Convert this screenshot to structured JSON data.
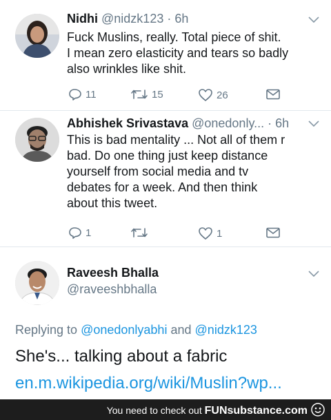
{
  "tweets": [
    {
      "name": "Nidhi",
      "handle": "@nidzk123",
      "time": "· 6h",
      "text": "Fuck Muslins, really. Total piece of shit.\nI mean zero elasticity and tears so badly\nalso wrinkles like shit.",
      "replies": "11",
      "retweets": "15",
      "likes": "26"
    },
    {
      "name": "Abhishek Srivastava",
      "handle": "@onedonly...",
      "time": "· 6h",
      "text": "This is bad mentality ... Not all of them r\nbad. Do one thing just keep distance\nyourself from social media and tv\ndebates for a week. And then think\nabout this tweet.",
      "replies": "1",
      "retweets": "",
      "likes": "1"
    }
  ],
  "main_tweet": {
    "name": "Raveesh Bhalla",
    "handle": "@raveeshbhalla",
    "replying_prefix": "Replying to",
    "replying_to_1": "@onedonlyabhi",
    "replying_and": "and",
    "replying_to_2": "@nidzk123",
    "text": "She's... talking about a fabric",
    "link": "en.m.wikipedia.org/wiki/Muslin?wp..."
  },
  "footer": {
    "prefix": "You need to check out",
    "brand": "FUNsubstance.com"
  },
  "colors": {
    "link": "#1b95e0",
    "muted": "#657786",
    "footer_bg": "#1d1d1d"
  }
}
